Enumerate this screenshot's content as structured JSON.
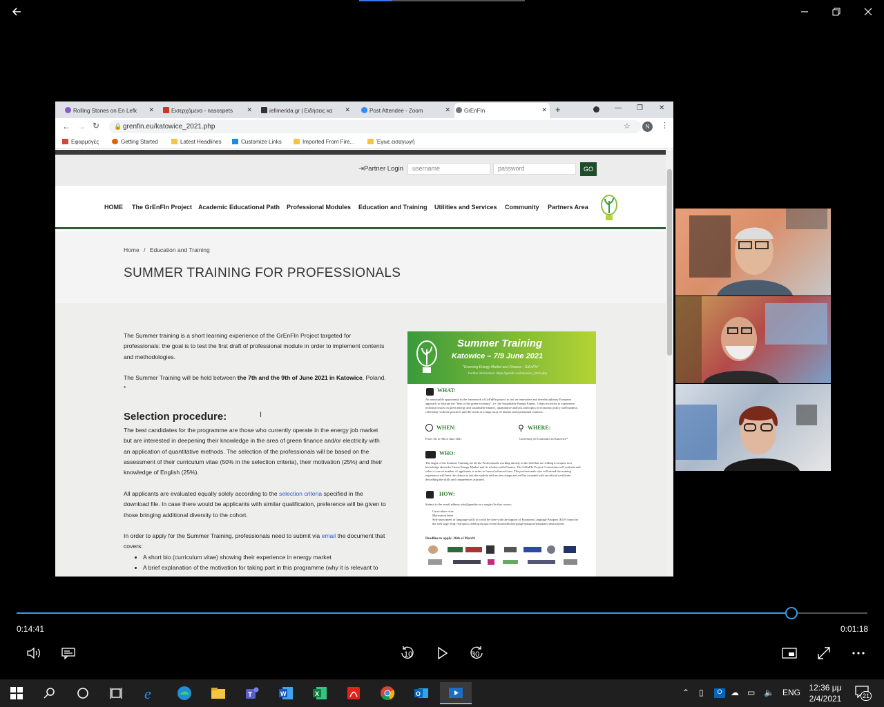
{
  "player": {
    "elapsed": "0:14:41",
    "remaining": "0:01:18",
    "progress_fraction": 0.911,
    "skip_back_label": "10",
    "skip_forward_label": "30"
  },
  "browser": {
    "tabs": [
      {
        "label": "Rolling Stones on En Lefk"
      },
      {
        "label": "Εισερχόμενα - nasospets"
      },
      {
        "label": "iefimerida.gr | Ειδήσεις κα"
      },
      {
        "label": "Post Attendee - Zoom"
      },
      {
        "label": "GrEnFIn"
      }
    ],
    "new_tab": "+",
    "url": "grenfin.eu/katowice_2021.php",
    "profile_initial": "N",
    "bookmarks": [
      "Εφαρμογές",
      "Getting Started",
      "Latest Headlines",
      "Customize Links",
      "Imported From Fire...",
      "Έγινε εισαγωγή"
    ]
  },
  "site": {
    "login_label": "Partner Login",
    "username_placeholder": "username",
    "password_placeholder": "password",
    "go_label": "GO",
    "nav": [
      "HOME",
      "The GrEnFIn Project",
      "Academic Educational Path",
      "Professional Modules",
      "Education and Training",
      "Utilities and Services",
      "Community",
      "Partners Area"
    ],
    "breadcrumb_home": "Home",
    "breadcrumb_sep": "/",
    "breadcrumb_current": "Education and Training",
    "page_title": "SUMMER TRAINING FOR PROFESSIONALS",
    "intro": "The Summer training is a short learning experience of the GrEnFIn Project targeted for professionals: the goal is to test the first draft of professional module in order to implement contents and methodologies.",
    "held_prefix": "The Summer Training will be held between ",
    "held_bold": "the 7th and the 9th of June 2021 in Katowice",
    "held_suffix": ", Poland. *",
    "section_heading": "Selection procedure:",
    "selection_text": "The best candidates for the programme are those who currently operate in the energy job market but are interested in deepening their knowledge in the area of green finance and/or electricity with an application of quantitative methods. The selection of the professionals will be based on the assessment of their curriculum vitae (50% in the selection criteria), their motivation (25%) and their knowledge of English (25%).",
    "applicants_prefix": "All applicants are evaluated equally solely according to the ",
    "applicants_link": "selection criteria",
    "applicants_suffix": " specified in the download file. In case there would be applicants with similar qualification, preference will be given to those bringing additional diversity to the cohort.",
    "apply_prefix": "In order to apply for the Summer Training, professionals need to submit via ",
    "apply_link": "email",
    "apply_suffix": " the document that covers:",
    "bullets": [
      "A short bio (curriculum vitae) showing their experience in energy market",
      "A brief explanation of the motivation for taking part in this programme (why it is relevant to"
    ]
  },
  "flyer": {
    "title": "Summer Training",
    "subtitle": "Katowice – 7/9 June 2021",
    "tagline": "\"Greening Energy Market and Finance - GrEnFIn\"",
    "info": "Further information: https://grenfin.eu/katowice_2021.php",
    "what_h": "WHAT:",
    "what_t": "An unmissable opportunity in the framework of GrEnFIn project to test an innovative and interdisciplinary European approach to educate the \"hero of the green economy\", i.e. the Sustainable Energy Expert. 3 days-activities to experience technical issues on green energy and sustainable finance, quantitative analysis and topics in economic policy and business, coherently with the practices and the needs of a large array of market and operational contexts.",
    "when_h": "WHEN:",
    "when_t": "From 7th to 9th of June 2021",
    "where_h": "WHERE:",
    "where_t": "University of Economics in Katowice*",
    "who_h": "WHO:",
    "who_t": "The target of the Summer Training are all the Professionals working already in the field but are willing to acquire new knowledge about the Green Energy Market and its relation with Finance. The GrEnFIn Project Consortium will evaluate and select a correct number of applicants in order to form a balanced class. The professionals who will attend the training experience will have the chance to test the module with no fee charge and will be awarded with an official certificate describing the skills and competences acquired.",
    "how_h": "HOW:",
    "how_t": "Submit to the email address info@grenfin.eu a single file that covers:",
    "how_items": [
      "Curriculum vitae",
      "Motivation letter",
      "Self-assessment of language skills (it could be done with the support of European Language Passport (ELP) found on the web page: http://europass.cedefop.europa.eu/en/documents/lan-guage-passport/templates-instructions)"
    ],
    "deadline": "Deadline to apply: 26th of March!"
  },
  "taskbar": {
    "lang": "ENG",
    "time": "12:36 μμ",
    "date": "2/4/2021",
    "notifications": "21"
  },
  "colors": {
    "accent": "#3b9ee8",
    "site_green": "#2e5e3a",
    "flyer_green": "#3a9a3a",
    "link": "#2a56c6"
  },
  "icons": [
    "back-arrow-icon",
    "minimize-icon",
    "restore-icon",
    "close-icon",
    "volume-icon",
    "subtitles-icon",
    "rewind-10-icon",
    "play-icon",
    "forward-30-icon",
    "mini-view-icon",
    "fullscreen-icon",
    "more-icon"
  ]
}
